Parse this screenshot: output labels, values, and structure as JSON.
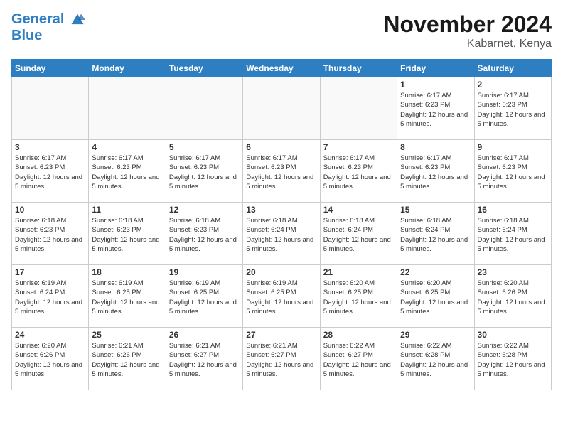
{
  "header": {
    "logo_line1": "General",
    "logo_line2": "Blue",
    "month": "November 2024",
    "location": "Kabarnet, Kenya"
  },
  "weekdays": [
    "Sunday",
    "Monday",
    "Tuesday",
    "Wednesday",
    "Thursday",
    "Friday",
    "Saturday"
  ],
  "weeks": [
    [
      {
        "day": "",
        "empty": true
      },
      {
        "day": "",
        "empty": true
      },
      {
        "day": "",
        "empty": true
      },
      {
        "day": "",
        "empty": true
      },
      {
        "day": "",
        "empty": true
      },
      {
        "day": "1",
        "sunrise": "Sunrise: 6:17 AM",
        "sunset": "Sunset: 6:23 PM",
        "daylight": "Daylight: 12 hours and 5 minutes."
      },
      {
        "day": "2",
        "sunrise": "Sunrise: 6:17 AM",
        "sunset": "Sunset: 6:23 PM",
        "daylight": "Daylight: 12 hours and 5 minutes."
      }
    ],
    [
      {
        "day": "3",
        "sunrise": "Sunrise: 6:17 AM",
        "sunset": "Sunset: 6:23 PM",
        "daylight": "Daylight: 12 hours and 5 minutes."
      },
      {
        "day": "4",
        "sunrise": "Sunrise: 6:17 AM",
        "sunset": "Sunset: 6:23 PM",
        "daylight": "Daylight: 12 hours and 5 minutes."
      },
      {
        "day": "5",
        "sunrise": "Sunrise: 6:17 AM",
        "sunset": "Sunset: 6:23 PM",
        "daylight": "Daylight: 12 hours and 5 minutes."
      },
      {
        "day": "6",
        "sunrise": "Sunrise: 6:17 AM",
        "sunset": "Sunset: 6:23 PM",
        "daylight": "Daylight: 12 hours and 5 minutes."
      },
      {
        "day": "7",
        "sunrise": "Sunrise: 6:17 AM",
        "sunset": "Sunset: 6:23 PM",
        "daylight": "Daylight: 12 hours and 5 minutes."
      },
      {
        "day": "8",
        "sunrise": "Sunrise: 6:17 AM",
        "sunset": "Sunset: 6:23 PM",
        "daylight": "Daylight: 12 hours and 5 minutes."
      },
      {
        "day": "9",
        "sunrise": "Sunrise: 6:17 AM",
        "sunset": "Sunset: 6:23 PM",
        "daylight": "Daylight: 12 hours and 5 minutes."
      }
    ],
    [
      {
        "day": "10",
        "sunrise": "Sunrise: 6:18 AM",
        "sunset": "Sunset: 6:23 PM",
        "daylight": "Daylight: 12 hours and 5 minutes."
      },
      {
        "day": "11",
        "sunrise": "Sunrise: 6:18 AM",
        "sunset": "Sunset: 6:23 PM",
        "daylight": "Daylight: 12 hours and 5 minutes."
      },
      {
        "day": "12",
        "sunrise": "Sunrise: 6:18 AM",
        "sunset": "Sunset: 6:23 PM",
        "daylight": "Daylight: 12 hours and 5 minutes."
      },
      {
        "day": "13",
        "sunrise": "Sunrise: 6:18 AM",
        "sunset": "Sunset: 6:24 PM",
        "daylight": "Daylight: 12 hours and 5 minutes."
      },
      {
        "day": "14",
        "sunrise": "Sunrise: 6:18 AM",
        "sunset": "Sunset: 6:24 PM",
        "daylight": "Daylight: 12 hours and 5 minutes."
      },
      {
        "day": "15",
        "sunrise": "Sunrise: 6:18 AM",
        "sunset": "Sunset: 6:24 PM",
        "daylight": "Daylight: 12 hours and 5 minutes."
      },
      {
        "day": "16",
        "sunrise": "Sunrise: 6:18 AM",
        "sunset": "Sunset: 6:24 PM",
        "daylight": "Daylight: 12 hours and 5 minutes."
      }
    ],
    [
      {
        "day": "17",
        "sunrise": "Sunrise: 6:19 AM",
        "sunset": "Sunset: 6:24 PM",
        "daylight": "Daylight: 12 hours and 5 minutes."
      },
      {
        "day": "18",
        "sunrise": "Sunrise: 6:19 AM",
        "sunset": "Sunset: 6:25 PM",
        "daylight": "Daylight: 12 hours and 5 minutes."
      },
      {
        "day": "19",
        "sunrise": "Sunrise: 6:19 AM",
        "sunset": "Sunset: 6:25 PM",
        "daylight": "Daylight: 12 hours and 5 minutes."
      },
      {
        "day": "20",
        "sunrise": "Sunrise: 6:19 AM",
        "sunset": "Sunset: 6:25 PM",
        "daylight": "Daylight: 12 hours and 5 minutes."
      },
      {
        "day": "21",
        "sunrise": "Sunrise: 6:20 AM",
        "sunset": "Sunset: 6:25 PM",
        "daylight": "Daylight: 12 hours and 5 minutes."
      },
      {
        "day": "22",
        "sunrise": "Sunrise: 6:20 AM",
        "sunset": "Sunset: 6:25 PM",
        "daylight": "Daylight: 12 hours and 5 minutes."
      },
      {
        "day": "23",
        "sunrise": "Sunrise: 6:20 AM",
        "sunset": "Sunset: 6:26 PM",
        "daylight": "Daylight: 12 hours and 5 minutes."
      }
    ],
    [
      {
        "day": "24",
        "sunrise": "Sunrise: 6:20 AM",
        "sunset": "Sunset: 6:26 PM",
        "daylight": "Daylight: 12 hours and 5 minutes."
      },
      {
        "day": "25",
        "sunrise": "Sunrise: 6:21 AM",
        "sunset": "Sunset: 6:26 PM",
        "daylight": "Daylight: 12 hours and 5 minutes."
      },
      {
        "day": "26",
        "sunrise": "Sunrise: 6:21 AM",
        "sunset": "Sunset: 6:27 PM",
        "daylight": "Daylight: 12 hours and 5 minutes."
      },
      {
        "day": "27",
        "sunrise": "Sunrise: 6:21 AM",
        "sunset": "Sunset: 6:27 PM",
        "daylight": "Daylight: 12 hours and 5 minutes."
      },
      {
        "day": "28",
        "sunrise": "Sunrise: 6:22 AM",
        "sunset": "Sunset: 6:27 PM",
        "daylight": "Daylight: 12 hours and 5 minutes."
      },
      {
        "day": "29",
        "sunrise": "Sunrise: 6:22 AM",
        "sunset": "Sunset: 6:28 PM",
        "daylight": "Daylight: 12 hours and 5 minutes."
      },
      {
        "day": "30",
        "sunrise": "Sunrise: 6:22 AM",
        "sunset": "Sunset: 6:28 PM",
        "daylight": "Daylight: 12 hours and 5 minutes."
      }
    ]
  ]
}
